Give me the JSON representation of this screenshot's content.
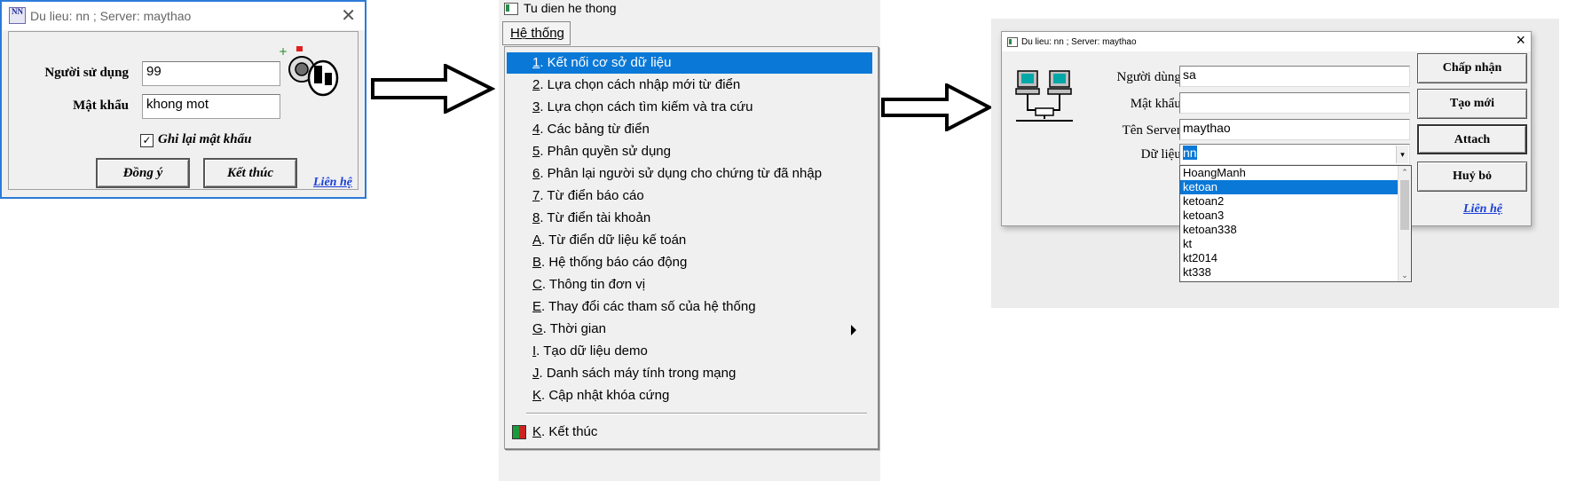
{
  "login_dialog": {
    "title": "Du lieu: nn ; Server: maythao",
    "app_icon_text": "NN",
    "user_label": "Người sử dụng",
    "user_value": "99",
    "password_label": "Mật khẩu",
    "password_value": "khong mot",
    "remember_label": "Ghi lại mật khẩu",
    "remember_checked": "✓",
    "ok_button": "Đồng ý",
    "exit_button": "Kết thúc",
    "contact_link": "Liên hệ"
  },
  "menu_window": {
    "title": "Tu dien he thong",
    "menu_label": "Hệ thống",
    "items": [
      {
        "key": "1",
        "label": ". Kết nối cơ sở dữ liệu"
      },
      {
        "key": "2",
        "label": ". Lựa chọn cách nhập  mới từ điển"
      },
      {
        "key": "3",
        "label": ". Lựa chọn cách tìm kiếm và tra cứu"
      },
      {
        "key": "4",
        "label": ". Các bảng từ điển"
      },
      {
        "key": "5",
        "label": ". Phân quyền sử dụng"
      },
      {
        "key": "6",
        "label": ". Phân lại người sử dụng cho chứng từ đã nhập"
      },
      {
        "key": "7",
        "label": ". Từ điển báo cáo"
      },
      {
        "key": "8",
        "label": ". Từ điển tài khoản"
      },
      {
        "key": "A",
        "label": ". Từ điển dữ liệu kế toán"
      },
      {
        "key": "B",
        "label": ". Hệ thống báo cáo động"
      },
      {
        "key": "C",
        "label": ". Thông tin đơn vị"
      },
      {
        "key": "E",
        "label": ". Thay đổi các tham số của hệ thống"
      },
      {
        "key": "G",
        "label": ". Thời gian"
      },
      {
        "key": "I",
        "label": ". Tạo dữ liệu demo"
      },
      {
        "key": "J",
        "label": ". Danh sách máy tính trong mạng"
      },
      {
        "key": "K",
        "label": ". Cập nhật khóa cứng"
      },
      {
        "key": "K",
        "label": ". Kết thúc"
      }
    ],
    "selected_index": 0,
    "submenu_index": 12
  },
  "connect_dialog": {
    "title": "Du lieu: nn ; Server: maythao",
    "user_label": "Người dùng:",
    "user_value": "sa",
    "password_label": "Mật khẩu:",
    "password_value": "",
    "server_label": "Tên Server:",
    "server_value": "maythao",
    "data_label": "Dữ liệu:",
    "data_value": "nn",
    "data_options": [
      "HoangManh",
      "ketoan",
      "ketoan2",
      "ketoan3",
      "ketoan338",
      "kt",
      "kt2014",
      "kt338"
    ],
    "data_selected": "ketoan",
    "accept_button": "Chấp nhận",
    "new_button": "Tạo mới",
    "attach_button": "Attach",
    "cancel_button": "Huỷ bỏ",
    "contact_link": "Liên hệ"
  },
  "colors": {
    "selection": "#0a78d7",
    "link": "#1a3fd8",
    "dialog_bg": "#f0f0f0",
    "border_accent": "#2b7ad8"
  }
}
